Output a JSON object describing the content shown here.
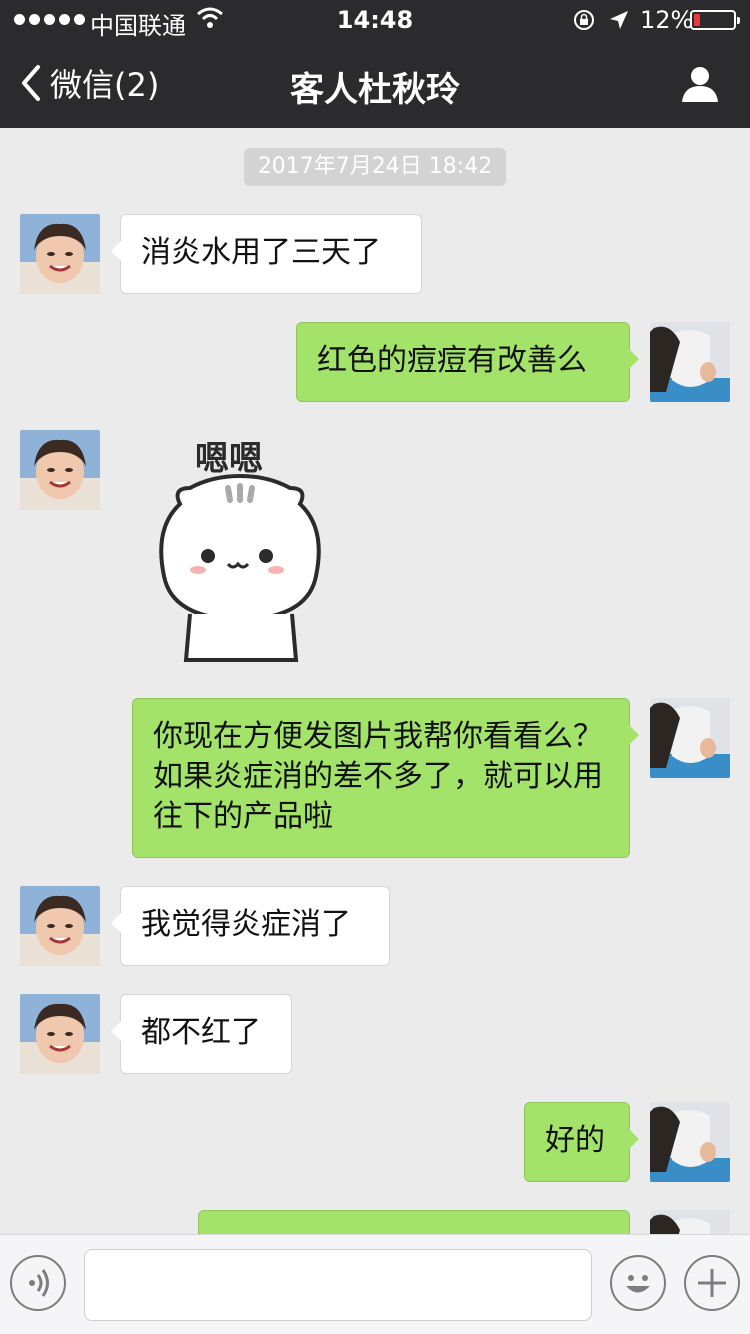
{
  "status_bar": {
    "carrier": "中国联通",
    "time": "14:48",
    "battery_percent": "12%"
  },
  "nav": {
    "back_label": "微信(2)",
    "title": "客人杜秋玲"
  },
  "chat": {
    "timestamp": "2017年7月24日 18:42",
    "messages": [
      {
        "side": "in",
        "text": "消炎水用了三天了"
      },
      {
        "side": "out",
        "text": "红色的痘痘有改善么"
      },
      {
        "side": "in",
        "sticker": "嗯嗯"
      },
      {
        "side": "out",
        "text": "你现在方便发图片我帮你看看么？如果炎症消的差不多了，就可以用往下的产品啦"
      },
      {
        "side": "in",
        "text": "我觉得炎症消了"
      },
      {
        "side": "in",
        "text": "都不红了"
      },
      {
        "side": "out",
        "text": "好的"
      },
      {
        "side": "out",
        "text": ""
      }
    ]
  },
  "icons": {
    "back": "chevron-left-icon",
    "profile": "person-icon",
    "voice": "voice-icon",
    "emoji": "emoji-icon",
    "plus": "plus-icon"
  },
  "colors": {
    "nav_bg": "#2b2b2e",
    "chat_bg": "#ebebeb",
    "out_bubble": "#a4e36a",
    "in_bubble": "#ffffff"
  }
}
